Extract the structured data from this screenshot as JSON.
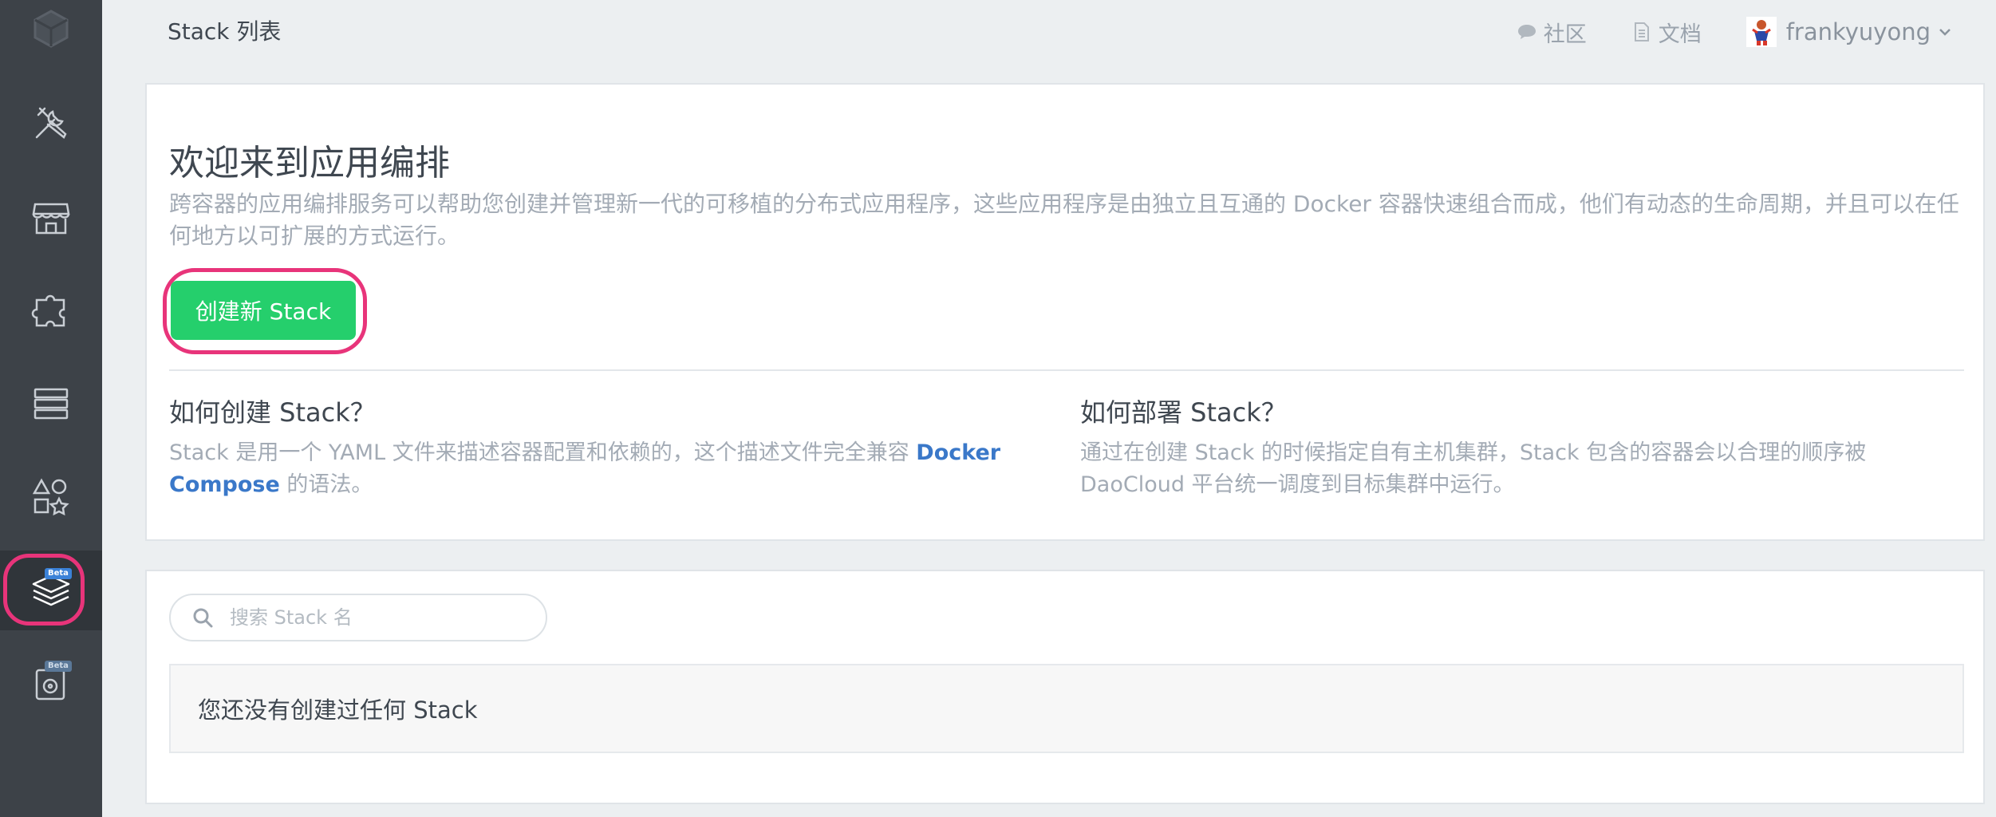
{
  "page": {
    "title": "Stack 列表"
  },
  "top_nav": {
    "community_label": "社区",
    "docs_label": "文档",
    "username": "frankyuyong"
  },
  "sidebar": {
    "items": [
      {
        "name": "logo",
        "icon": "cube-logo-icon"
      },
      {
        "name": "tools",
        "icon": "tools-icon"
      },
      {
        "name": "store",
        "icon": "store-icon"
      },
      {
        "name": "integrations",
        "icon": "puzzle-icon"
      },
      {
        "name": "servers",
        "icon": "server-icon"
      },
      {
        "name": "services",
        "icon": "shapes-icon"
      },
      {
        "name": "stacks",
        "icon": "layers-icon",
        "badge": "Beta",
        "active": true
      },
      {
        "name": "volumes",
        "icon": "disk-icon",
        "badge": "Beta"
      }
    ]
  },
  "welcome": {
    "title": "欢迎来到应用编排",
    "description": "跨容器的应用编排服务可以帮助您创建并管理新一代的可移植的分布式应用程序，这些应用程序是由独立且互通的 Docker 容器快速组合而成，他们有动态的生命周期，并且可以在任何地方以可扩展的方式运行。",
    "create_button": "创建新 Stack"
  },
  "howto_create": {
    "title": "如何创建 Stack？",
    "text_before": "Stack 是用一个 YAML 文件来描述容器配置和依赖的，这个描述文件完全兼容 ",
    "link": "Docker Compose",
    "text_after": " 的语法。"
  },
  "howto_deploy": {
    "title": "如何部署 Stack？",
    "text": "通过在创建 Stack 的时候指定自有主机集群，Stack 包含的容器会以合理的顺序被 DaoCloud 平台统一调度到目标集群中运行。"
  },
  "list": {
    "search_placeholder": "搜索 Stack 名",
    "empty_message": "您还没有创建过任何 Stack"
  },
  "colors": {
    "sidebar_bg": "#3d4248",
    "primary_green": "#25cf6c",
    "highlight_ring": "#e8347a",
    "link_blue": "#3a78c9",
    "page_bg": "#eceff1"
  }
}
